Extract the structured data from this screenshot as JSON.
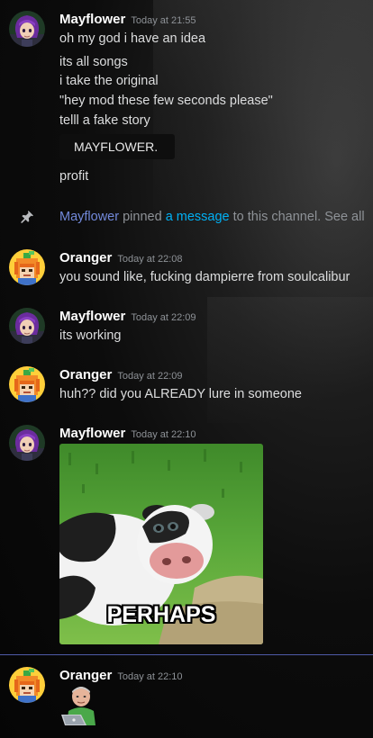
{
  "messages": [
    {
      "author": "Mayflower",
      "timestamp": "Today at 21:55",
      "lines": [
        "oh my god i have an idea",
        "its all songs",
        "i take the original",
        "\"hey mod these few seconds please\"",
        "telll a fake story"
      ],
      "code": "MAYFLOWER.",
      "after": "profit"
    },
    {
      "author": "Oranger",
      "timestamp": "Today at 22:08",
      "lines": [
        "you sound like, fucking dampierre from soulcalibur"
      ]
    },
    {
      "author": "Mayflower",
      "timestamp": "Today at 22:09",
      "lines": [
        "its working"
      ]
    },
    {
      "author": "Oranger",
      "timestamp": "Today at 22:09",
      "lines": [
        "huh?? did you ALREADY lure in someone"
      ]
    },
    {
      "author": "Mayflower",
      "timestamp": "Today at 22:10",
      "image_caption": "PERHAPS"
    },
    {
      "author": "Oranger",
      "timestamp": "Today at 22:10"
    }
  ],
  "system": {
    "user": "Mayflower",
    "text1": " pinned ",
    "link": "a message",
    "text2": " to this channel. See all"
  },
  "icons": {
    "pin": "pin-icon",
    "mayflower_avatar": "purple-haired-anime-character",
    "oranger_avatar": "orange-haired-pixel-character",
    "emoji": "old-man-at-laptop"
  },
  "colors": {
    "username": "#ffffff",
    "timestamp": "#8e9297",
    "text": "#dcddde",
    "mention": "#7289da",
    "link": "#00b0f4",
    "new_divider": "#4f5ba8"
  }
}
